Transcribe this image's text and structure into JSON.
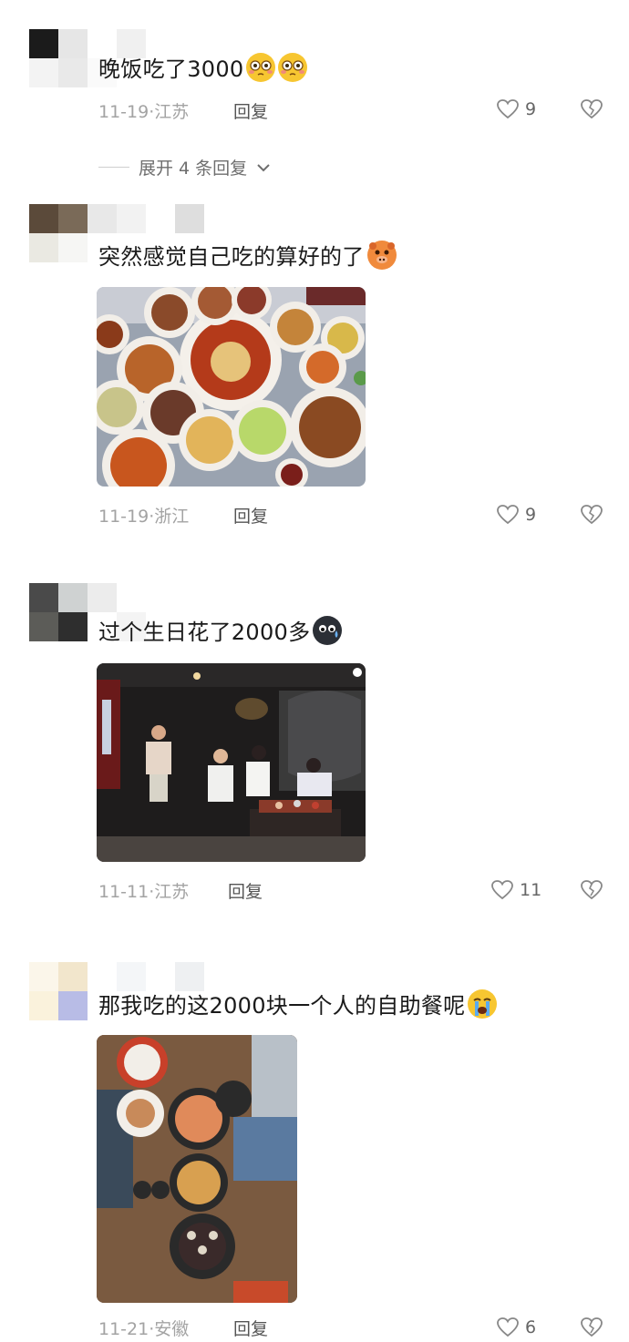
{
  "comments": [
    {
      "text": "晚饭吃了3000",
      "emoji_icons": [
        "flushed-face-icon",
        "flushed-face-icon"
      ],
      "time": "11-19",
      "location": "江苏",
      "reply_label": "回复",
      "likes": "9",
      "expand_label": "展开 4 条回复"
    },
    {
      "text": "突然感觉自己吃的算好的了",
      "emoji_icons": [
        "pig-face-icon"
      ],
      "time": "11-19",
      "location": "浙江",
      "reply_label": "回复",
      "likes": "9"
    },
    {
      "text": "过个生日花了2000多",
      "emoji_icons": [
        "sweat-face-icon"
      ],
      "time": "11-11",
      "location": "江苏",
      "reply_label": "回复",
      "likes": "11"
    },
    {
      "text": "那我吃的这2000块一个人的自助餐呢",
      "emoji_icons": [
        "crying-face-icon"
      ],
      "time": "11-21",
      "location": "安徽",
      "reply_label": "回复",
      "likes": "6"
    }
  ],
  "meta_separator": "·",
  "colors": {
    "meta_gray": "#a3a3a3",
    "emoji_yellow": "#f7c631",
    "emoji_orange": "#f08a3c"
  }
}
